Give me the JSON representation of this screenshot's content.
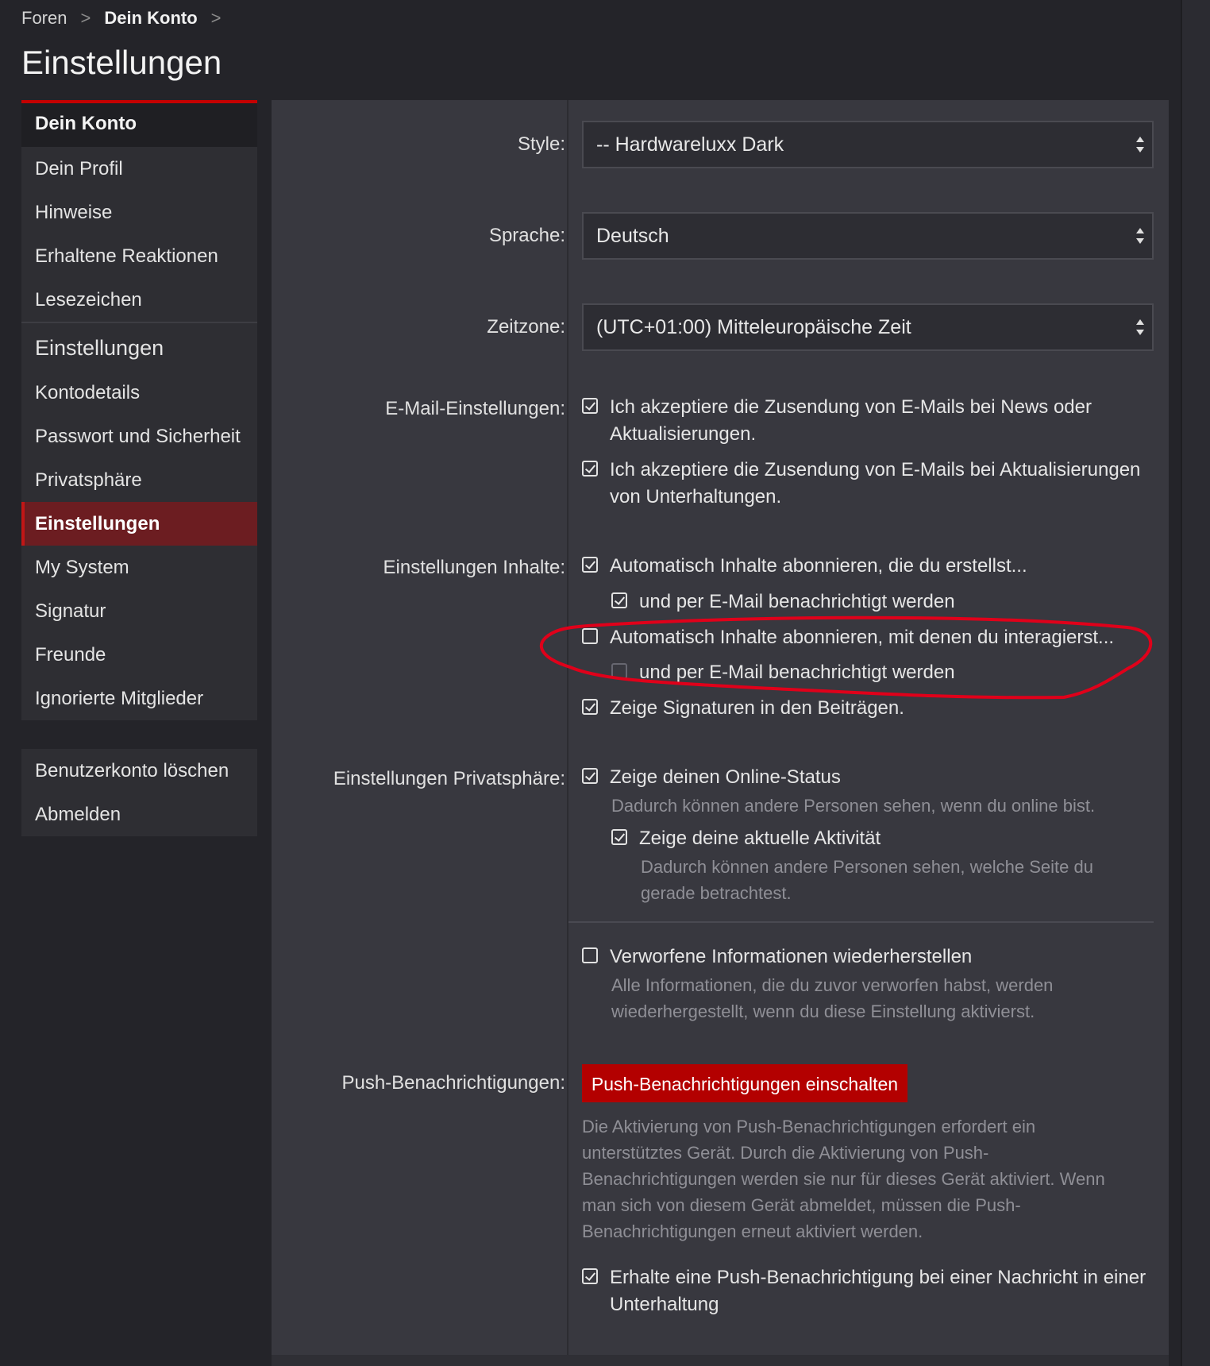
{
  "breadcrumb": {
    "item1": "Foren",
    "item2": "Dein Konto",
    "sep": ">"
  },
  "page_title": "Einstellungen",
  "sidebar": {
    "group1_header": "Dein Konto",
    "group1_items": [
      "Dein Profil",
      "Hinweise",
      "Erhaltene Reaktionen",
      "Lesezeichen"
    ],
    "group2_header": "Einstellungen",
    "group2_items": [
      "Kontodetails",
      "Passwort und Sicherheit",
      "Privatsphäre",
      "Einstellungen",
      "My System",
      "Signatur",
      "Freunde",
      "Ignorierte Mitglieder"
    ],
    "group3_items": [
      "Benutzerkonto löschen",
      "Abmelden"
    ]
  },
  "form": {
    "style_label": "Style:",
    "style_value": "-- Hardwareluxx Dark",
    "language_label": "Sprache:",
    "language_value": "Deutsch",
    "timezone_label": "Zeitzone:",
    "timezone_value": "(UTC+01:00) Mitteleuropäische Zeit",
    "email_label": "E-Mail-Einstellungen:",
    "email_opt1": "Ich akzeptiere die Zusendung von E-Mails bei News oder Aktualisierungen.",
    "email_opt2": "Ich akzeptiere die Zusendung von E-Mails bei Aktualisierungen von Unterhaltungen.",
    "content_label": "Einstellungen Inhalte:",
    "content_opt1": "Automatisch Inhalte abonnieren, die du erstellst...",
    "content_opt1_sub": "und per E-Mail benachrichtigt werden",
    "content_opt2": "Automatisch Inhalte abonnieren, mit denen du interagierst...",
    "content_opt2_sub": "und per E-Mail benachrichtigt werden",
    "content_opt3": "Zeige Signaturen in den Beiträgen.",
    "privacy_label": "Einstellungen Privatsphäre:",
    "privacy_opt1": "Zeige deinen Online-Status",
    "privacy_opt1_hint": "Dadurch können andere Personen sehen, wenn du online bist.",
    "privacy_opt2": "Zeige deine aktuelle Aktivität",
    "privacy_opt2_hint": "Dadurch können andere Personen sehen, welche Seite du gerade betrachtest.",
    "restore_opt": "Verworfene Informationen wiederherstellen",
    "restore_hint": "Alle Informationen, die du zuvor verworfen habst, werden wiederhergestellt, wenn du diese Einstellung aktivierst.",
    "push_label": "Push-Benachrichtigungen:",
    "push_button": "Push-Benachrichtigungen einschalten",
    "push_hint": "Die Aktivierung von Push-Benachrichtigungen erfordert ein unterstütztes Gerät. Durch die Aktivierung von Push-Benachrichtigungen werden sie nur für dieses Gerät aktiviert. Wenn man sich von diesem Gerät abmeldet, müssen die Push-Benachrichtigungen erneut aktiviert werden.",
    "push_opt": "Erhalte eine Push-Benachrichtigung bei einer Nachricht in einer Unterhaltung"
  },
  "colors": {
    "accent": "#c40000",
    "active_bg": "#6c1d21",
    "annotation": "#e0001a",
    "button": "#b30000"
  }
}
